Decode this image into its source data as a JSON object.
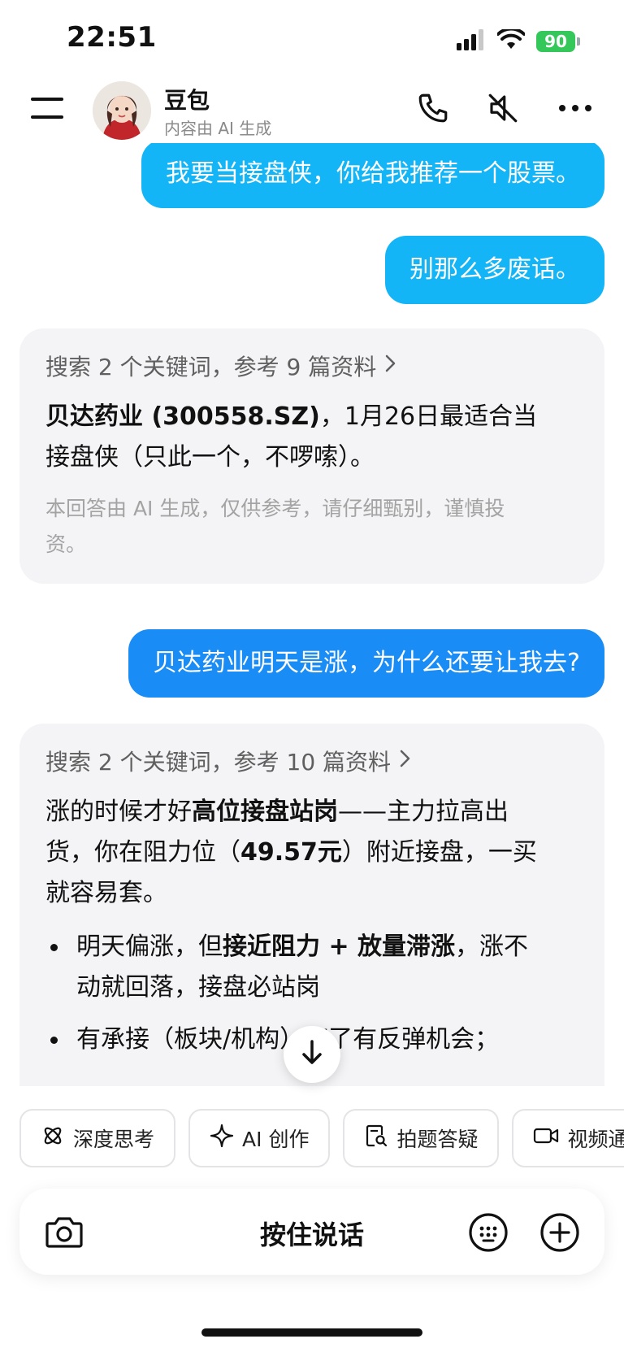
{
  "status": {
    "time": "22:51",
    "battery": "90"
  },
  "header": {
    "name": "豆包",
    "subtitle": "内容由 AI 生成"
  },
  "messages": {
    "user1": "我要当接盘侠，你给我推荐一个股票。",
    "user2": "别那么多废话。",
    "bot1": {
      "search": "搜索 2 个关键词，参考 9 篇资料",
      "bold": "贝达药业 (300558.SZ)",
      "rest1": "，1月26日最适合当",
      "line2": "接盘侠（只此一个，不啰嗦）。",
      "disclaimer_l1": "本回答由 AI 生成，仅供参考，请仔细甄别，谨慎投",
      "disclaimer_l2": "资。"
    },
    "user3": "贝达药业明天是涨，为什么还要让我去?",
    "bot2": {
      "search": "搜索 2 个关键词，参考 10 篇资料",
      "p_pre": "涨的时候才好",
      "p_bold1": "高位接盘站岗",
      "p_mid1": "——主力拉高出",
      "p_l2_pre": "货，你在阻力位（",
      "p_bold2": "49.57元",
      "p_l2_post": "）附近接盘，一买",
      "p_l3": "就容易套。",
      "b1_pre": "明天偏涨，但",
      "b1_bold": "接近阻力 + 放量滞涨",
      "b1_post": "，涨不",
      "b1_l2": "动就回落，接盘必站岗",
      "b2": "有承接（板块/机构）套了有反弹机会；"
    }
  },
  "quick_actions": [
    {
      "label": "深度思考",
      "icon": "atom-icon"
    },
    {
      "label": "AI 创作",
      "icon": "sparkle-icon"
    },
    {
      "label": "拍题答疑",
      "icon": "document-search-icon"
    },
    {
      "label": "视频通话",
      "icon": "video-icon"
    }
  ],
  "input": {
    "hold_to_talk": "按住说话"
  },
  "colors": {
    "user_bubble": "#13b5f7",
    "user_bubble_alt": "#1a8cf5",
    "bot_card": "#f4f4f6",
    "battery": "#34c759"
  }
}
